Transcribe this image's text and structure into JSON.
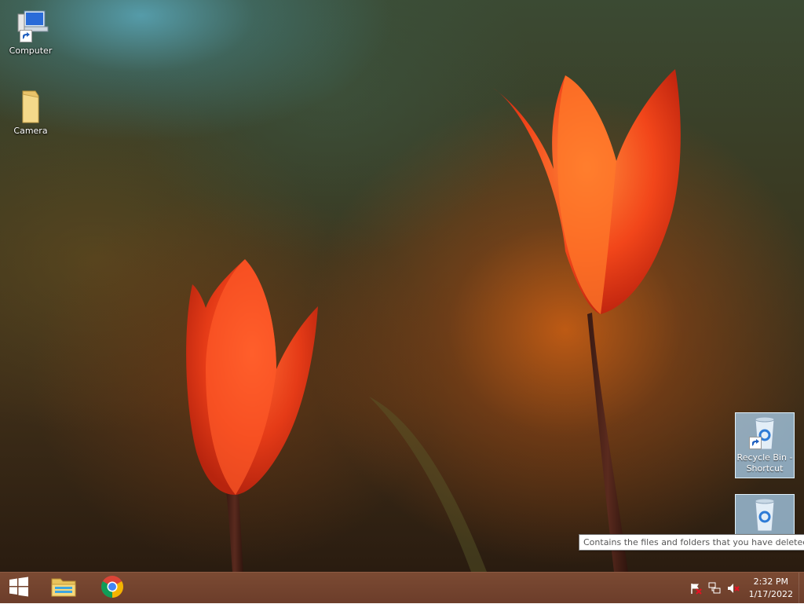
{
  "desktop": {
    "icons": [
      {
        "label": "Computer",
        "icon": "computer-icon"
      },
      {
        "label": "Camera",
        "icon": "folder-icon"
      },
      {
        "label_line1": "Recycle Bin -",
        "label_line2": "Shortcut",
        "icon": "recycle-bin-icon"
      },
      {
        "label": "",
        "icon": "recycle-bin-icon"
      }
    ],
    "tooltip": "Contains the files and folders that you have deleted."
  },
  "taskbar": {
    "start_icon": "windows-logo-icon",
    "pinned": [
      {
        "icon": "file-explorer-icon"
      },
      {
        "icon": "chrome-icon"
      }
    ],
    "tray": {
      "icons": [
        "action-center-flag-icon",
        "network-icon",
        "volume-muted-icon"
      ],
      "time": "2:32 PM",
      "date": "1/17/2022"
    }
  },
  "colors": {
    "taskbar": "#6f402c",
    "tooltip_bg": "#ffffff",
    "selection": "#aad2f0"
  }
}
